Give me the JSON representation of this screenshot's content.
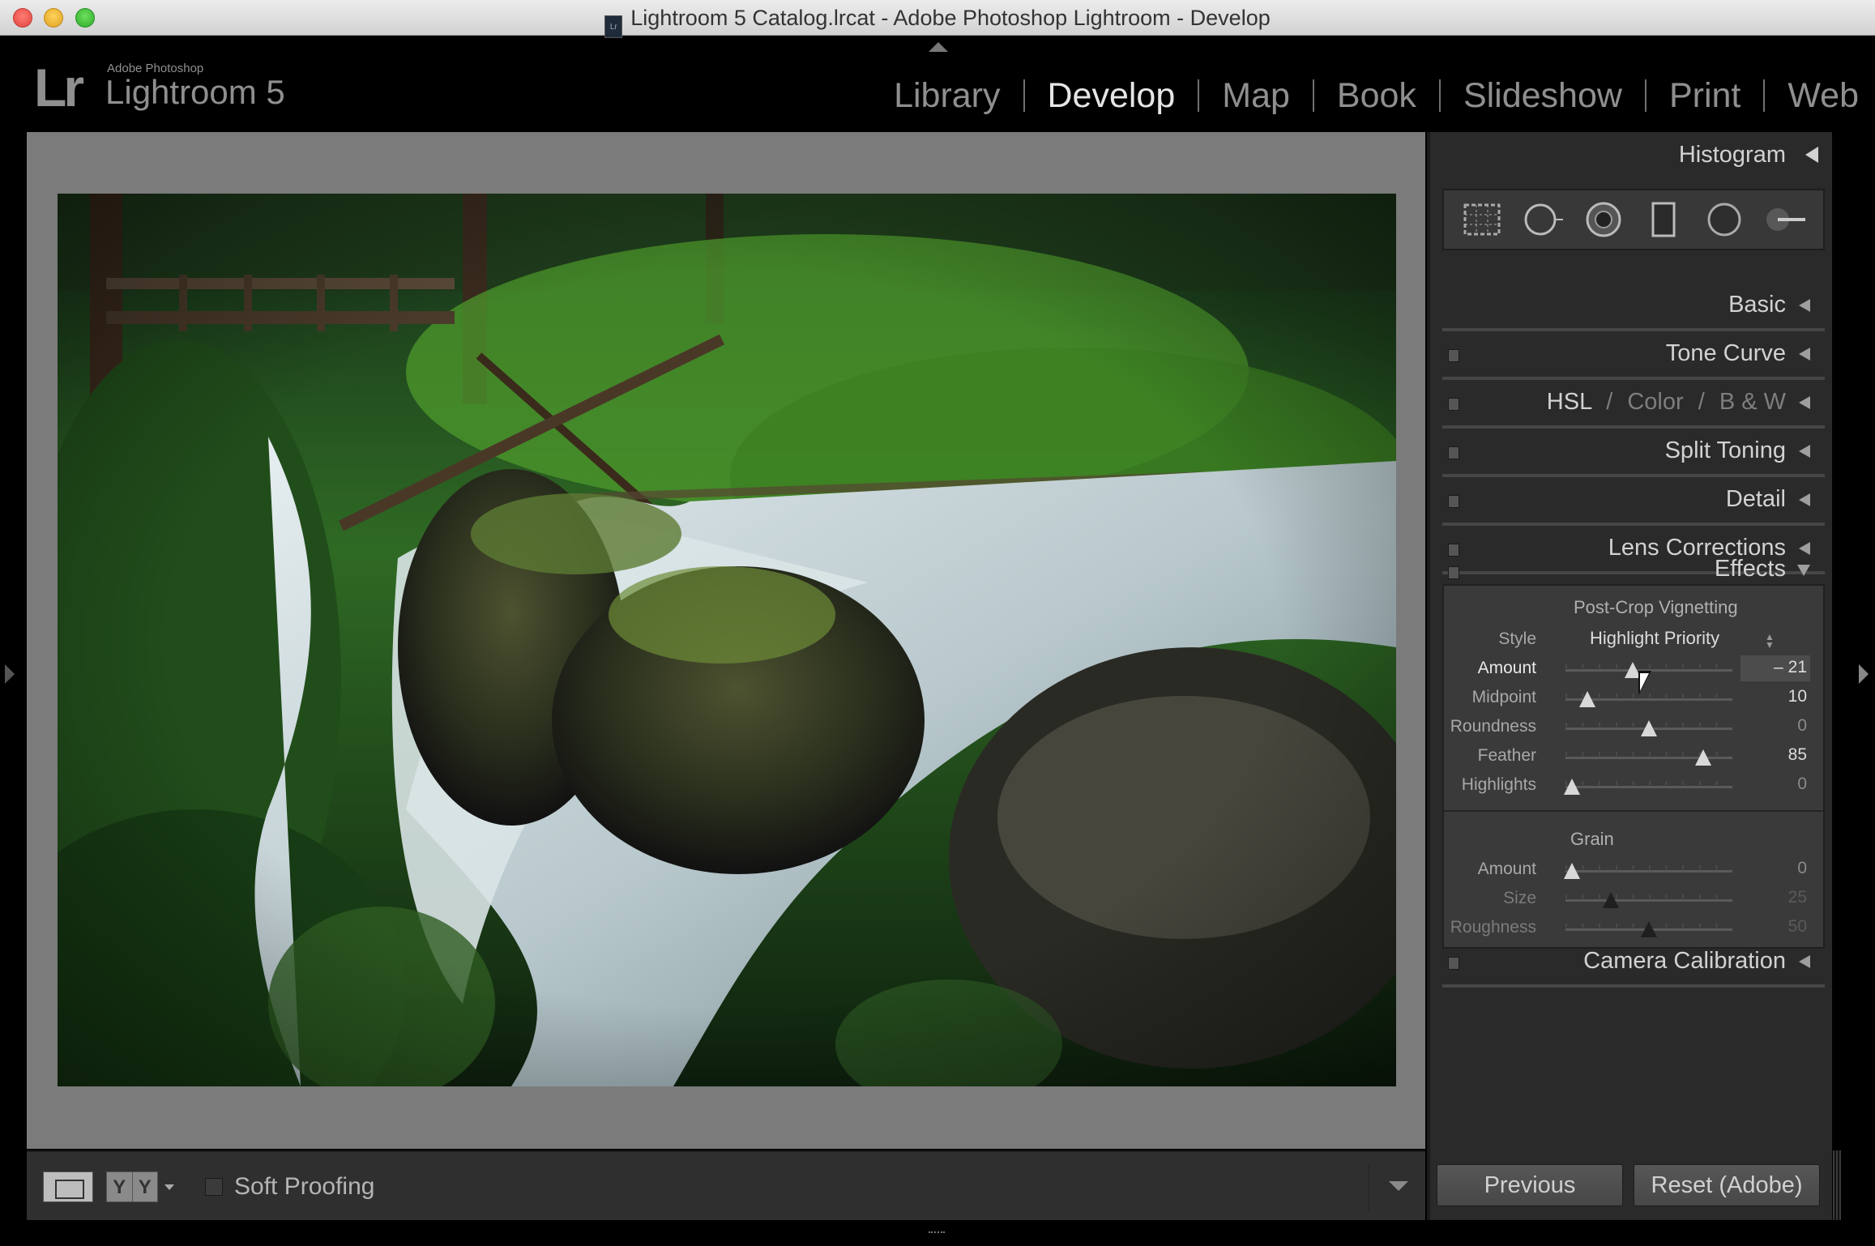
{
  "window": {
    "title": "Lightroom 5 Catalog.lrcat - Adobe Photoshop Lightroom - Develop",
    "doc_icon": "Lr"
  },
  "logo": {
    "mark": "Lr",
    "vendor": "Adobe Photoshop",
    "product": "Lightroom 5"
  },
  "modules": [
    {
      "label": "Library",
      "active": false
    },
    {
      "label": "Develop",
      "active": true
    },
    {
      "label": "Map",
      "active": false
    },
    {
      "label": "Book",
      "active": false
    },
    {
      "label": "Slideshow",
      "active": false
    },
    {
      "label": "Print",
      "active": false
    },
    {
      "label": "Web",
      "active": false
    }
  ],
  "photo": {
    "subject": "waterfall-in-forest"
  },
  "toolbar": {
    "yy_left": "Y",
    "yy_right": "Y",
    "soft_proofing_label": "Soft Proofing",
    "soft_proofing_checked": false
  },
  "right_panel": {
    "histogram_title": "Histogram",
    "tool_icons": [
      "crop-overlay-icon",
      "spot-removal-icon",
      "red-eye-icon",
      "graduated-filter-icon",
      "radial-filter-icon",
      "adjustment-brush-icon"
    ],
    "panels": {
      "basic": "Basic",
      "tone_curve": "Tone Curve",
      "hsl": "HSL",
      "hsl_sep": "/",
      "color": "Color",
      "bw": "B & W",
      "split_toning": "Split Toning",
      "detail": "Detail",
      "lens_corrections": "Lens Corrections",
      "effects": "Effects",
      "camera_calibration": "Camera Calibration"
    },
    "effects": {
      "vignetting_title": "Post-Crop Vignetting",
      "style_label": "Style",
      "style_value": "Highlight Priority",
      "amount": {
        "label": "Amount",
        "value": "– 21",
        "min": -100,
        "max": 100,
        "num": -21
      },
      "midpoint": {
        "label": "Midpoint",
        "value": "10",
        "min": 0,
        "max": 100,
        "num": 10
      },
      "roundness": {
        "label": "Roundness",
        "value": "0",
        "min": -100,
        "max": 100,
        "num": 0
      },
      "feather": {
        "label": "Feather",
        "value": "85",
        "min": 0,
        "max": 100,
        "num": 85
      },
      "highlights": {
        "label": "Highlights",
        "value": "0",
        "min": 0,
        "max": 100,
        "num": 0
      },
      "grain_title": "Grain",
      "grain_amount": {
        "label": "Amount",
        "value": "0",
        "min": 0,
        "max": 100,
        "num": 0
      },
      "grain_size": {
        "label": "Size",
        "value": "25",
        "min": 0,
        "max": 100,
        "num": 25
      },
      "grain_roughness": {
        "label": "Roughness",
        "value": "50",
        "min": 0,
        "max": 100,
        "num": 50
      }
    },
    "previous_button": "Previous",
    "reset_button": "Reset (Adobe)"
  },
  "colors": {
    "panel_bg": "#2a2a2a",
    "active_module": "#e6e6e6",
    "inactive_module": "#8f8f8f",
    "canvas_bg": "#7b7b7b"
  }
}
